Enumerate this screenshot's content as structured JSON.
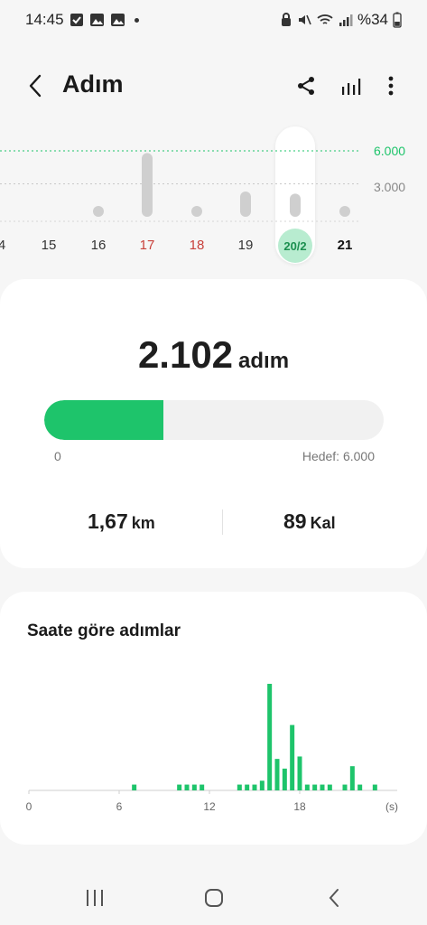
{
  "status": {
    "time": "14:45",
    "battery": "%34"
  },
  "header": {
    "title": "Adım"
  },
  "week": {
    "goal_labels": [
      "6.000",
      "3.000"
    ],
    "days": [
      {
        "label": "4",
        "style": "normal",
        "value": 0
      },
      {
        "label": "15",
        "style": "normal",
        "value": 0
      },
      {
        "label": "16",
        "style": "normal",
        "value": 250
      },
      {
        "label": "17",
        "style": "red",
        "value": 5800
      },
      {
        "label": "18",
        "style": "red",
        "value": 180
      },
      {
        "label": "19",
        "style": "normal",
        "value": 2300
      },
      {
        "label": "20/2",
        "style": "selected",
        "value": 2102
      },
      {
        "label": "21",
        "style": "bold",
        "value": 250
      }
    ]
  },
  "summary": {
    "steps": "2.102",
    "steps_unit": "adım",
    "progress_fraction": 0.35,
    "progress_min": "0",
    "goal": "Hedef: 6.000",
    "distance": "1,67",
    "distance_unit": "km",
    "calories": "89",
    "calories_unit": "Kal"
  },
  "hourly": {
    "title": "Saate göre adımlar"
  },
  "colors": {
    "accent": "#1ec46b",
    "accent_light": "#b8ecd0",
    "weekend": "#c8413b",
    "bar_gray": "#cfcfcf"
  },
  "chart_data": {
    "type": "bar",
    "title": "Saate göre adımlar",
    "xlabel": "(s)",
    "x_ticks": [
      "0",
      "6",
      "12",
      "18"
    ],
    "xlim": [
      0,
      24
    ],
    "x": [
      7,
      10,
      10.5,
      11,
      11.5,
      14,
      14.5,
      15,
      15.5,
      16,
      16.5,
      17,
      17.5,
      18,
      18.5,
      19,
      19.5,
      20,
      21,
      21.5,
      22,
      23
    ],
    "values": [
      12,
      12,
      12,
      12,
      12,
      12,
      12,
      12,
      20,
      220,
      65,
      45,
      135,
      70,
      12,
      12,
      12,
      12,
      12,
      50,
      12,
      12
    ]
  }
}
